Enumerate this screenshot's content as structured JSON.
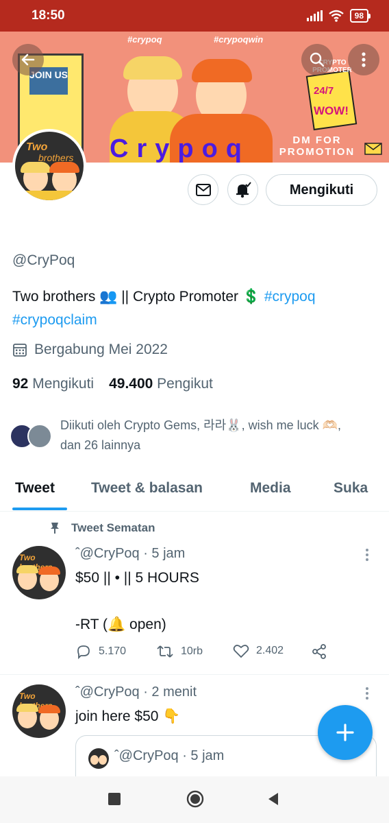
{
  "status_bar": {
    "time": "18:50",
    "battery": "98"
  },
  "banner": {
    "tag_left": "#crypoq",
    "tag_right": "#crypoqwin",
    "join_text": "JOIN US",
    "brand": "Crypoq",
    "promo_top": "CRYPTO PROMOTER",
    "promo_mid": "24/7",
    "promo_wow": "WOW!",
    "dm_text": "DM FOR PROMOTION"
  },
  "profile": {
    "follow_button": "Mengikuti",
    "handle": "@CryPoq",
    "bio_text": "Two brothers 👥 || Crypto Promoter 💲",
    "bio_tag1": "#crypoq",
    "bio_tag2": "#crypoqclaim",
    "joined": "Bergabung Mei 2022",
    "following_count": "92",
    "following_label": "Mengikuti",
    "followers_count": "49.400",
    "followers_label": "Pengikut",
    "followed_by": "Diikuti oleh Crypto Gems, 라라🐰, wish me luck 🫶🏻, dan 26 lainnya"
  },
  "tabs": [
    {
      "label": "Tweet"
    },
    {
      "label": "Tweet & balasan"
    },
    {
      "label": "Media"
    },
    {
      "label": "Suka"
    }
  ],
  "pinned_label": "Tweet Sematan",
  "tweets": [
    {
      "handle_line": "ˆ@CryPoq · 5 jam",
      "line1": "$50 || • || 5 HOURS",
      "line2": "-RT (🔔 open)",
      "replies": "5.170",
      "retweets": "10rb",
      "likes": "2.402"
    },
    {
      "handle_line": "ˆ@CryPoq · 2 menit",
      "line1": "join here $50 👇",
      "quote_handle": "ˆ@CryPoq · 5 jam"
    }
  ],
  "colors": {
    "accent": "#1d9bf0",
    "status_bar": "#b52a1e",
    "banner": "#f2917b"
  }
}
